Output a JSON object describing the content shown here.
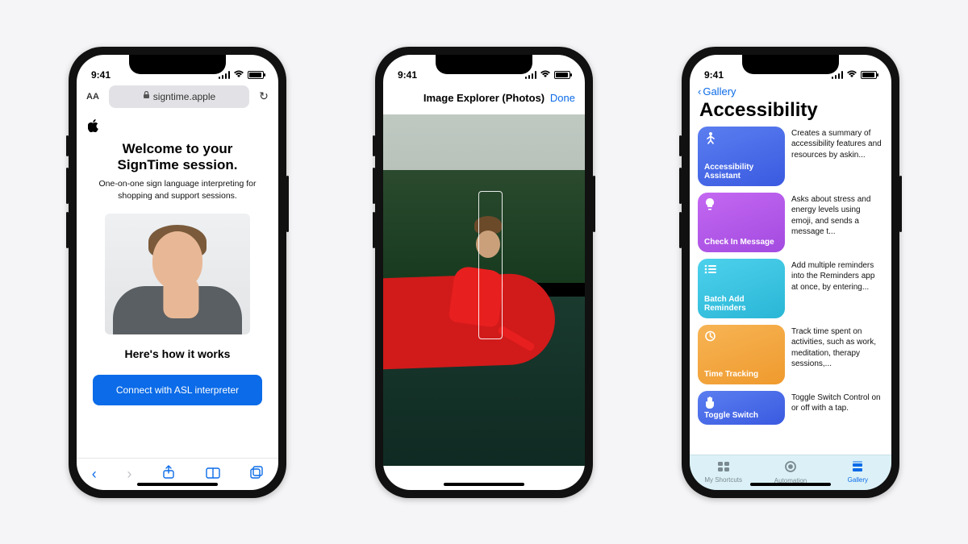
{
  "status": {
    "time": "9:41"
  },
  "phone1": {
    "aa": "AA",
    "url": "signtime.apple",
    "lock": "🔒",
    "title_line1": "Welcome to your",
    "title_line2": "SignTime session.",
    "subtitle": "One-on-one sign language interpreting for shopping and support sessions.",
    "how": "Here's how it works",
    "connect": "Connect with ASL interpreter"
  },
  "phone2": {
    "title": "Image Explorer (Photos)",
    "done": "Done"
  },
  "phone3": {
    "back": "Gallery",
    "title": "Accessibility",
    "items": [
      {
        "label": "Accessibility Assistant",
        "icon": "person",
        "color": "#4b73e8",
        "desc": "Creates a summary of accessibility features and resources by askin..."
      },
      {
        "label": "Check In Message",
        "icon": "bulb",
        "color": "#b35ee8",
        "desc": "Asks about stress and energy levels using emoji, and sends a message t..."
      },
      {
        "label": "Batch Add Reminders",
        "icon": "list",
        "color": "#3bc4e3",
        "desc": "Add multiple reminders into the Reminders app at once, by entering..."
      },
      {
        "label": "Time Tracking",
        "icon": "timer",
        "color": "#f2a33c",
        "desc": "Track time spent on activities, such as work, meditation, therapy sessions,..."
      },
      {
        "label": "Toggle Switch",
        "icon": "hand",
        "color": "#4b73e8",
        "desc": "Toggle Switch Control on or off with a tap."
      }
    ],
    "tabs": [
      {
        "label": "My Shortcuts",
        "active": false
      },
      {
        "label": "Automation",
        "active": false
      },
      {
        "label": "Gallery",
        "active": true
      }
    ]
  }
}
